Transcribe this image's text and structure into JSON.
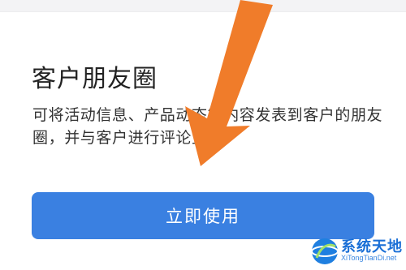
{
  "title": "客户朋友圈",
  "description_lines": [
    "可将活动信息、产品动态等内容发表到客户的朋友",
    "圈，并与客户进行评论互动。"
  ],
  "primary_button": {
    "label": "立即使用"
  },
  "annotation": {
    "icon": "arrow-icon",
    "color": "#f07c2a"
  },
  "watermark": {
    "title": "系统天地",
    "domain": "XiTongTianDi.net"
  },
  "colors": {
    "accent": "#3a80e1",
    "background": "#ffffff"
  }
}
